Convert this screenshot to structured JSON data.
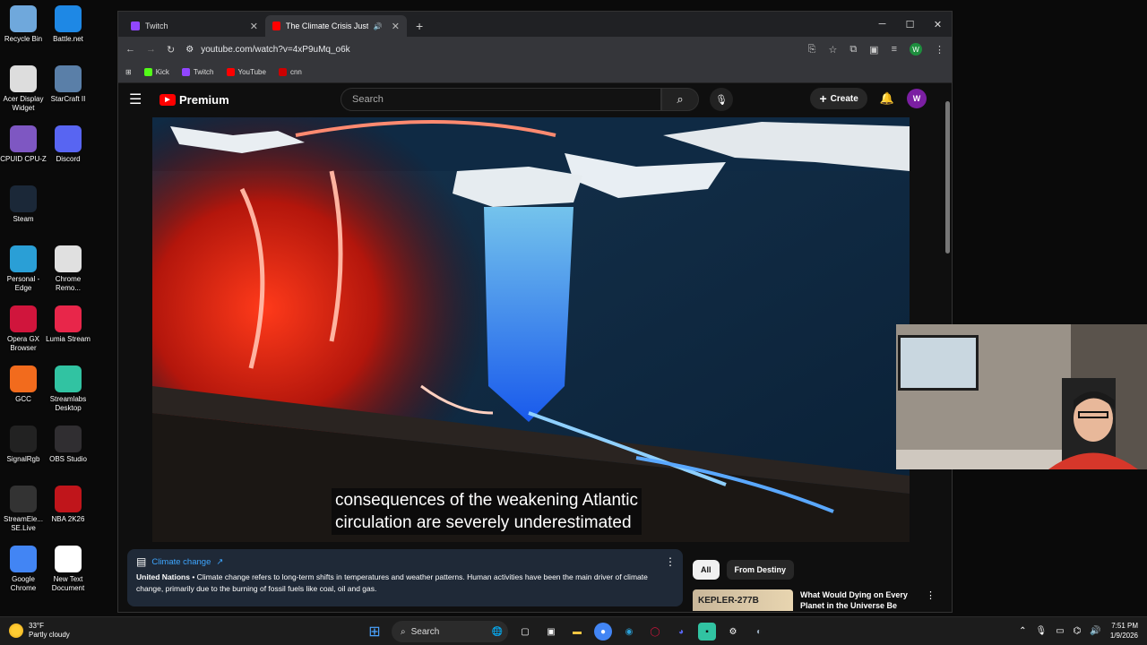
{
  "desktop": {
    "icons": [
      {
        "label": "Recycle Bin",
        "icon": "recycle-bin-icon",
        "color": "#6fa8dc"
      },
      {
        "label": "Battle.net",
        "icon": "battlenet-icon",
        "color": "#1e88e5"
      },
      {
        "label": "Acer Display Widget",
        "icon": "acer-widget-icon",
        "color": "#dddddd"
      },
      {
        "label": "StarCraft II",
        "icon": "starcraft-icon",
        "color": "#5a7fa8"
      },
      {
        "label": "CPUID CPU-Z",
        "icon": "cpuz-icon",
        "color": "#7e57c2"
      },
      {
        "label": "Discord",
        "icon": "discord-icon",
        "color": "#5865f2"
      },
      {
        "label": "Steam",
        "icon": "steam-icon",
        "color": "#1b2838"
      },
      {
        "label": "Personal - Edge",
        "icon": "edge-icon",
        "color": "#2a9fd6"
      },
      {
        "label": "Chrome Remo...",
        "icon": "chrome-remote-icon",
        "color": "#e0e0e0"
      },
      {
        "label": "Opera GX Browser",
        "icon": "opera-gx-icon",
        "color": "#d0153c"
      },
      {
        "label": "Lumia Stream",
        "icon": "lumia-icon",
        "color": "#e8264a"
      },
      {
        "label": "GCC",
        "icon": "gcc-icon",
        "color": "#f26b1d"
      },
      {
        "label": "Streamlabs Desktop",
        "icon": "streamlabs-icon",
        "color": "#31c3a2"
      },
      {
        "label": "SignalRgb",
        "icon": "signalrgb-icon",
        "color": "#222222"
      },
      {
        "label": "OBS Studio",
        "icon": "obs-icon",
        "color": "#302e31"
      },
      {
        "label": "StreamEle... SE.Live",
        "icon": "streamelements-icon",
        "color": "#333333"
      },
      {
        "label": "NBA 2K26",
        "icon": "nba2k-icon",
        "color": "#c0151b"
      },
      {
        "label": "Google Chrome",
        "icon": "chrome-icon",
        "color": "#4285f4"
      },
      {
        "label": "New Text Document",
        "icon": "text-document-icon",
        "color": "#ffffff"
      }
    ]
  },
  "browser": {
    "tabs": [
      {
        "title": "Twitch",
        "fav_color": "#9146ff",
        "active": false
      },
      {
        "title": "The Climate Crisis Just Hit a",
        "fav_color": "#ff0000",
        "active": true
      }
    ],
    "url": "youtube.com/watch?v=4xP9uMq_o6k",
    "bookmarks": [
      {
        "label": "Kick",
        "color": "#53fc18"
      },
      {
        "label": "Twitch",
        "color": "#9146ff"
      },
      {
        "label": "YouTube",
        "color": "#ff0000"
      },
      {
        "label": "cnn",
        "color": "#cc0000"
      }
    ],
    "profile_initial": "W"
  },
  "youtube": {
    "logo_text": "Premium",
    "search_placeholder": "Search",
    "create_label": "Create",
    "avatar_initial": "W",
    "caption_line1": "consequences of the weakening Atlantic",
    "caption_line2": "circulation are severely underestimated",
    "info_card": {
      "title": "Climate change",
      "source": "United Nations",
      "text": " • Climate change refers to long-term shifts in temperatures and weather patterns. Human activities have been the main driver of climate change, primarily due to the burning of fossil fuels like coal, oil and gas."
    },
    "chips": [
      "All",
      "From Destiny"
    ],
    "recommendation": {
      "thumb_text": "KEPLER-277B",
      "title": "What Would Dying on Every Planet in the Universe Be Like?"
    }
  },
  "taskbar": {
    "weather_temp": "33°F",
    "weather_desc": "Partly cloudy",
    "search_label": "Search",
    "time": "7:51 PM",
    "date": "1/9/2026"
  }
}
